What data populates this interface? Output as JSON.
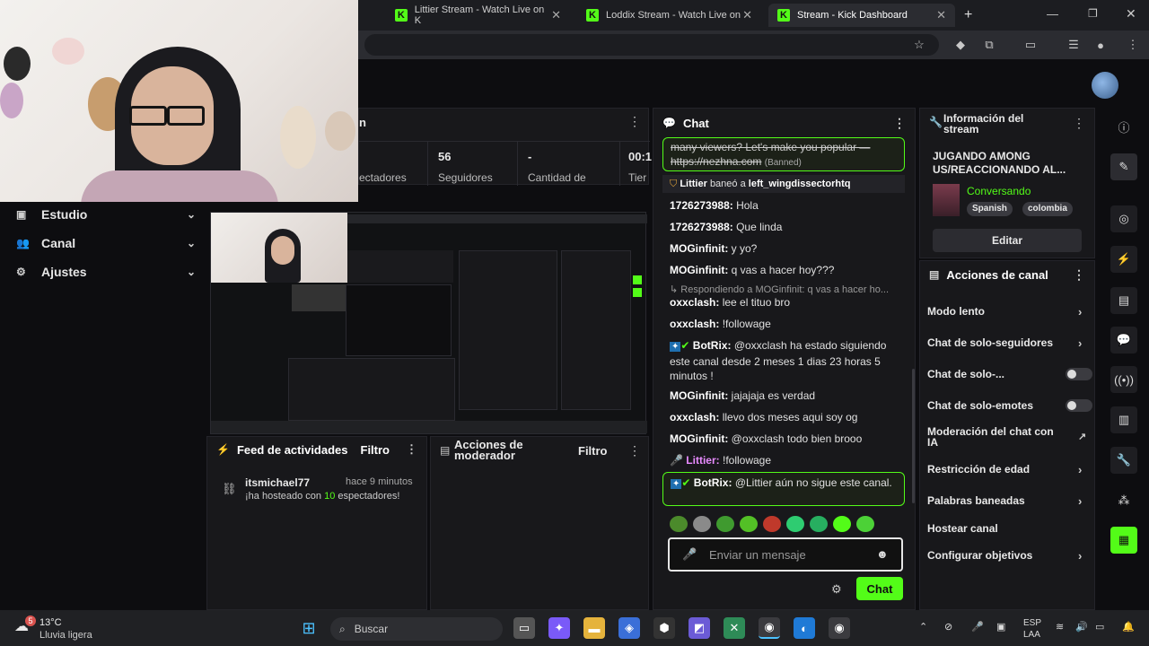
{
  "browser": {
    "tabs": [
      {
        "title": "Littier Stream - Watch Live on K"
      },
      {
        "title": "Loddix Stream - Watch Live on"
      },
      {
        "title": "Stream - Kick Dashboard"
      }
    ],
    "new_tab": "+"
  },
  "sidebar": {
    "items": [
      {
        "label": "Estudio"
      },
      {
        "label": "Canal"
      },
      {
        "label": "Ajustes"
      }
    ]
  },
  "stats": {
    "title_fragment": "n",
    "items": [
      {
        "value": "",
        "label": "ectadores"
      },
      {
        "value": "56",
        "label": "Seguidores"
      },
      {
        "value": "-",
        "label": "Cantidad de"
      },
      {
        "value": "00:1",
        "label": "Tier"
      }
    ]
  },
  "chat": {
    "title": "Chat",
    "messages": [
      {
        "user": "",
        "text": "many viewers? Let's make you popular — https://nezhna.com",
        "tag": "(Banned)"
      },
      {
        "user": "Littier",
        "text": "baneó a",
        "target": "left_wingdissectorhtq"
      },
      {
        "user": "1726273988:",
        "text": "Hola"
      },
      {
        "user": "1726273988:",
        "text": "Que linda"
      },
      {
        "user": "MOGinfinit:",
        "text": "y yo?"
      },
      {
        "user": "MOGinfinit:",
        "text": "q vas a hacer hoy???"
      },
      {
        "reply": "Respondiendo a MOGinfinit: q vas a hacer ho..."
      },
      {
        "user": "oxxclash:",
        "text": "lee el tituo bro"
      },
      {
        "user": "oxxclash:",
        "text": "!followage"
      },
      {
        "user": "BotRix:",
        "text": "@oxxclash ha estado siguiendo este canal desde 2 meses 1 dias 23 horas 5 minutos !"
      },
      {
        "user": "MOGinfinit:",
        "text": "jajajaja es verdad"
      },
      {
        "user": "oxxclash:",
        "text": "llevo dos meses aqui soy og"
      },
      {
        "user": "MOGinfinit:",
        "text": "@oxxclash todo bien brooo"
      },
      {
        "user": "Littier:",
        "text": "!followage"
      },
      {
        "user": "BotRix:",
        "text": "@Littier aún no sigue este canal."
      }
    ],
    "input_placeholder": "Enviar un mensaje",
    "send_label": "Chat"
  },
  "stream_info": {
    "title": "Información del stream",
    "stream_title": "JUGANDO AMONG US/REACCIONANDO AL...",
    "category": "Conversando",
    "tags": [
      "Spanish",
      "colombia"
    ],
    "edit_label": "Editar"
  },
  "channel_actions": {
    "title": "Acciones de canal",
    "items": [
      {
        "label": "Modo lento",
        "kind": "chevron"
      },
      {
        "label": "Chat de solo-seguidores",
        "kind": "chevron"
      },
      {
        "label": "Chat de solo-...",
        "kind": "toggle"
      },
      {
        "label": "Chat de solo-emotes",
        "kind": "toggle"
      },
      {
        "label": "Moderación del chat con IA",
        "kind": "external"
      },
      {
        "label": "Restricción de edad",
        "kind": "chevron"
      },
      {
        "label": "Palabras baneadas",
        "kind": "chevron"
      },
      {
        "label": "Hostear canal",
        "kind": "none"
      },
      {
        "label": "Configurar objetivos",
        "kind": "chevron"
      }
    ]
  },
  "activity": {
    "title": "Feed de actividades",
    "filter": "Filtro",
    "event": {
      "user": "itsmichael77",
      "time": "hace 9 minutos",
      "text_pre": "¡ha hosteado con ",
      "count": "10",
      "text_post": " espectadores!"
    }
  },
  "mod_actions": {
    "title": "Acciones de moderador",
    "filter": "Filtro"
  },
  "taskbar": {
    "weather_temp": "13°C",
    "weather_desc": "Lluvia ligera",
    "weather_badge": "5",
    "search": "Buscar",
    "lang_top": "ESP",
    "lang_bottom": "LAA"
  },
  "colors": {
    "accent": "#53fc18",
    "panel": "#18181b",
    "background": "#0d0d10"
  }
}
